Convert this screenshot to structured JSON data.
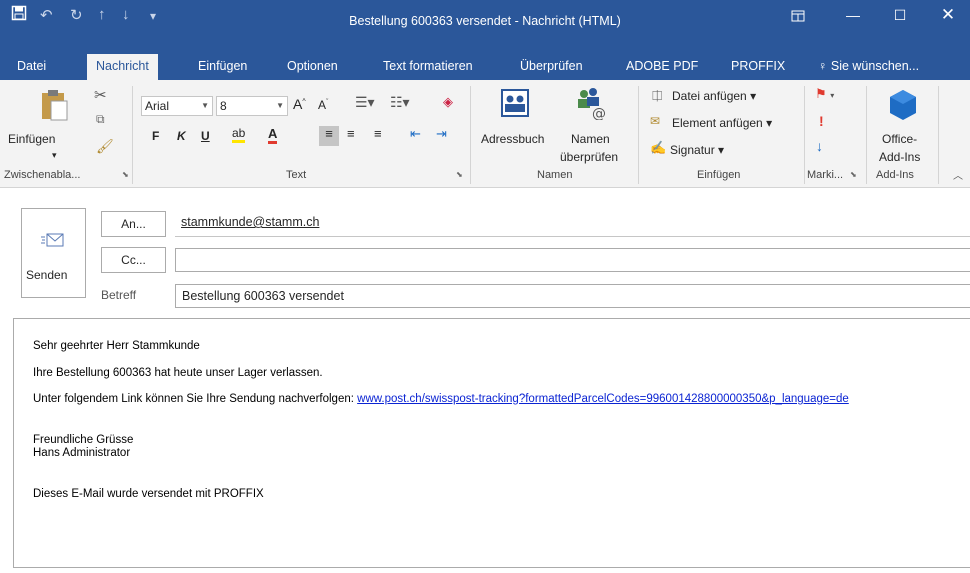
{
  "window": {
    "title": "Bestellung 600363 versendet  -  Nachricht (HTML)",
    "quick_access": [
      "save-icon",
      "undo-icon",
      "redo-icon",
      "up-icon",
      "down-icon",
      "customize-icon"
    ],
    "controls": [
      "restore-icon",
      "minimize-icon",
      "maximize-icon",
      "close-icon"
    ]
  },
  "tabs": [
    {
      "label": "Datei"
    },
    {
      "label": "Nachricht",
      "active": true
    },
    {
      "label": "Einfügen"
    },
    {
      "label": "Optionen"
    },
    {
      "label": "Text formatieren"
    },
    {
      "label": "Überprüfen"
    },
    {
      "label": "ADOBE PDF"
    },
    {
      "label": "PROFFIX"
    },
    {
      "label": "Sie wünschen..."
    }
  ],
  "ribbon": {
    "clipboard": {
      "paste_label": "Einfügen",
      "group_label": "Zwischenabla..."
    },
    "text": {
      "font": "Arial",
      "size": "8",
      "bold": "F",
      "italic": "K",
      "underline": "U",
      "group_label": "Text"
    },
    "names": {
      "address_book": "Adressbuch",
      "check_names_1": "Namen",
      "check_names_2": "überprüfen",
      "group_label": "Namen"
    },
    "include": {
      "attach_file": "Datei anfügen",
      "attach_item": "Element anfügen",
      "signature": "Signatur",
      "group_label": "Einfügen"
    },
    "tags": {
      "group_label": "Marki..."
    },
    "addins": {
      "office_1": "Office-",
      "office_2": "Add-Ins",
      "group_label": "Add-Ins"
    }
  },
  "header": {
    "send_label": "Senden",
    "to_label": "An...",
    "to_value": "stammkunde@stamm.ch",
    "cc_label": "Cc...",
    "cc_value": "",
    "subject_label": "Betreff",
    "subject_value": "Bestellung 600363 versendet"
  },
  "body": {
    "greeting": "Sehr geehrter Herr Stammkunde",
    "line1": "Ihre Bestellung 600363 hat heute unser Lager verlassen.",
    "line2_prefix": "Unter folgendem Link können Sie Ihre Sendung nachverfolgen: ",
    "tracking_link": "www.post.ch/swisspost-tracking?formattedParcelCodes=996001428800000350&p_language=de",
    "closing": "Freundliche Grüsse",
    "signature_name": "Hans Administrator",
    "footer": "Dieses E-Mail wurde versendet mit PROFFIX"
  },
  "colors": {
    "accent": "#2b579a",
    "ribbon_bg": "#f3f3f3",
    "link": "#0b24d3",
    "flag_red": "#e03a2f",
    "arrow_blue": "#1e6cc4"
  }
}
